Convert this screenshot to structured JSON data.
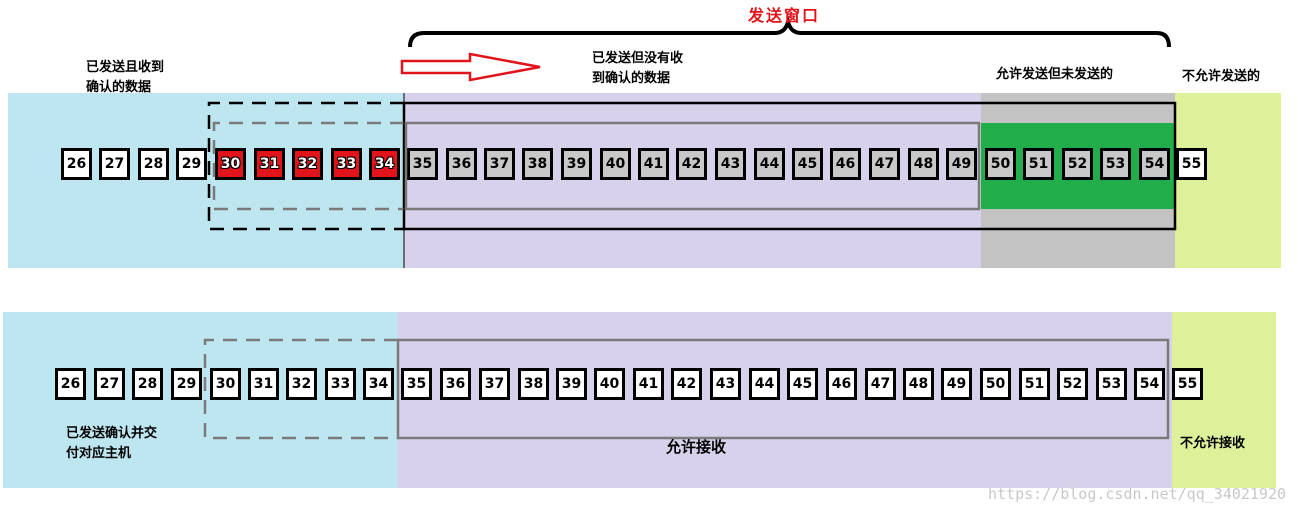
{
  "title": "发送窗口",
  "colors": {
    "acked": "#bde6f0",
    "window": "#d7d1ec",
    "gray_band": "#c3c3c3",
    "green": "#21ad4a",
    "not_allowed": "#ddf19b",
    "red_cell": "#e1141c",
    "gray_cell": "#c8c8c8",
    "title": "#e1141c"
  },
  "sender": {
    "labels": {
      "acked": [
        "已发送且收到",
        "确认的数据"
      ],
      "sent_not_acked": [
        "已发送但没有收",
        "到确认的数据"
      ],
      "allowed_not_sent": "允许发送但未发送的",
      "not_allowed": "不允许发送的"
    },
    "cells": [
      {
        "n": "26",
        "state": "acked"
      },
      {
        "n": "27",
        "state": "acked"
      },
      {
        "n": "28",
        "state": "acked"
      },
      {
        "n": "29",
        "state": "acked"
      },
      {
        "n": "30",
        "state": "red"
      },
      {
        "n": "31",
        "state": "red"
      },
      {
        "n": "32",
        "state": "red"
      },
      {
        "n": "33",
        "state": "red"
      },
      {
        "n": "34",
        "state": "red"
      },
      {
        "n": "35",
        "state": "sent"
      },
      {
        "n": "36",
        "state": "sent"
      },
      {
        "n": "37",
        "state": "sent"
      },
      {
        "n": "38",
        "state": "sent"
      },
      {
        "n": "39",
        "state": "sent"
      },
      {
        "n": "40",
        "state": "sent"
      },
      {
        "n": "41",
        "state": "sent"
      },
      {
        "n": "42",
        "state": "sent"
      },
      {
        "n": "43",
        "state": "sent"
      },
      {
        "n": "44",
        "state": "sent"
      },
      {
        "n": "45",
        "state": "sent"
      },
      {
        "n": "46",
        "state": "sent"
      },
      {
        "n": "47",
        "state": "sent"
      },
      {
        "n": "48",
        "state": "sent"
      },
      {
        "n": "49",
        "state": "sent"
      },
      {
        "n": "50",
        "state": "sent"
      },
      {
        "n": "51",
        "state": "sent"
      },
      {
        "n": "52",
        "state": "sent"
      },
      {
        "n": "53",
        "state": "sent"
      },
      {
        "n": "54",
        "state": "sent"
      },
      {
        "n": "55",
        "state": "none"
      }
    ]
  },
  "receiver": {
    "labels": {
      "delivered": [
        "已发送确认并交",
        "付对应主机"
      ],
      "allowed": "允许接收",
      "not_allowed": "不允许接收"
    },
    "cells": [
      "26",
      "27",
      "28",
      "29",
      "30",
      "31",
      "32",
      "33",
      "34",
      "35",
      "36",
      "37",
      "38",
      "39",
      "40",
      "41",
      "42",
      "43",
      "44",
      "45",
      "46",
      "47",
      "48",
      "49",
      "50",
      "51",
      "52",
      "53",
      "54",
      "55"
    ]
  },
  "watermark": "https://blog.csdn.net/qq_34021920"
}
